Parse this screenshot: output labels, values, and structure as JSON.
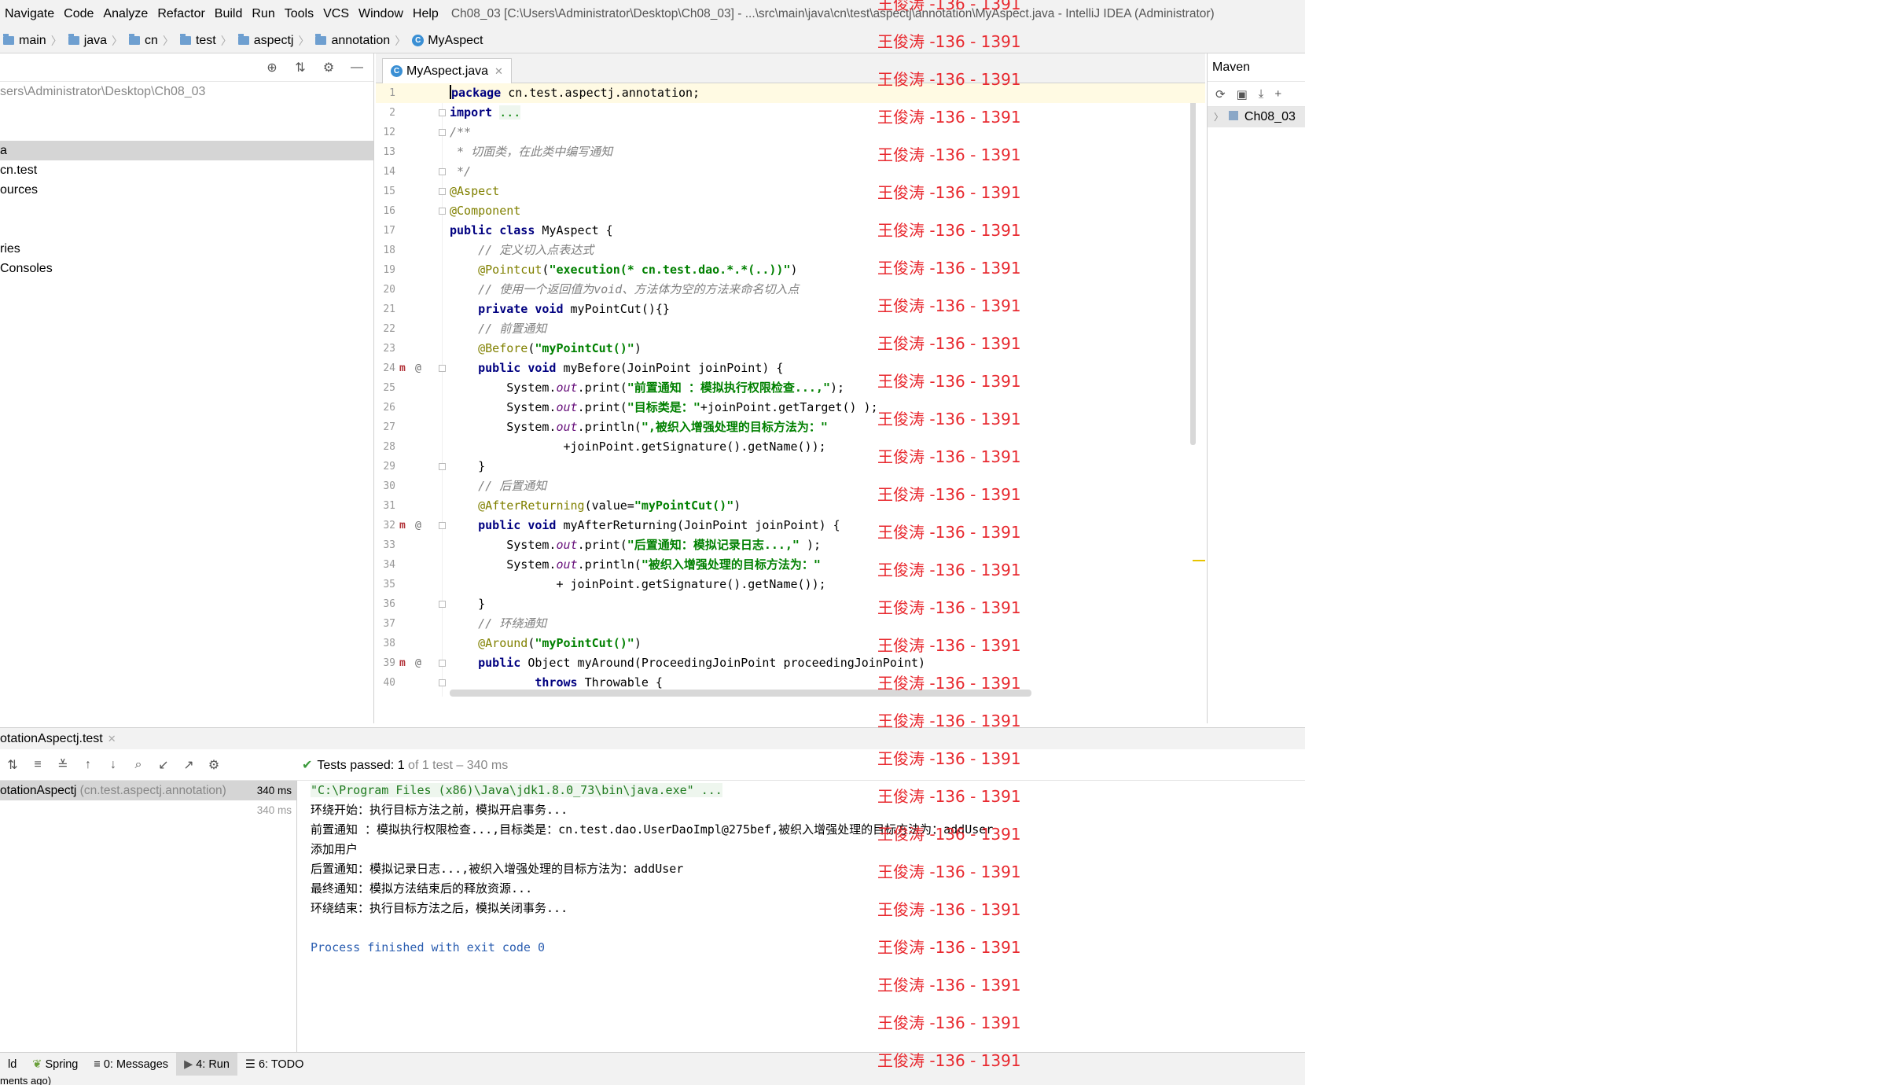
{
  "menubar": {
    "items": [
      "Navigate",
      "Code",
      "Analyze",
      "Refactor",
      "Build",
      "Run",
      "Tools",
      "VCS",
      "Window",
      "Help"
    ],
    "title": "Ch08_03 [C:\\Users\\Administrator\\Desktop\\Ch08_03] - ...\\src\\main\\java\\cn\\test\\aspectj\\annotation\\MyAspect.java - IntelliJ IDEA (Administrator)"
  },
  "breadcrumb": [
    "main",
    "java",
    "cn",
    "test",
    "aspectj",
    "annotation",
    "MyAspect"
  ],
  "project": {
    "path": "sers\\Administrator\\Desktop\\Ch08_03",
    "rows": [
      "",
      "a",
      "cn.test",
      "ources",
      "",
      "ries",
      " Consoles"
    ]
  },
  "editor": {
    "tab": "MyAspect.java",
    "lines": [
      {
        "n": "1",
        "html": "<span class=\"caret\"></span><span class=\"kw\">package</span> cn.test.aspectj.annotation;",
        "cur": true
      },
      {
        "n": "2",
        "html": "<span class=\"kw\">import</span> <span class=\"str\" style=\"font-weight:normal;background:#eef6ee\">...</span>"
      },
      {
        "n": "12",
        "html": "<span class=\"cmt\">/**</span>"
      },
      {
        "n": "13",
        "html": "<span class=\"cmt\"> * 切面类，在此类中编写通知</span>"
      },
      {
        "n": "14",
        "html": "<span class=\"cmt\"> */</span>"
      },
      {
        "n": "15",
        "html": "<span class=\"ann\">@Aspect</span>"
      },
      {
        "n": "16",
        "html": "<span class=\"ann\">@Component</span>"
      },
      {
        "n": "17",
        "html": "<span class=\"kw\">public class</span> MyAspect {"
      },
      {
        "n": "18",
        "html": "    <span class=\"cmt\">// 定义切入点表达式</span>"
      },
      {
        "n": "19",
        "html": "    <span class=\"ann\">@Pointcut</span>(<span class=\"str\">\"execution(* cn.test.dao.*.*(..))\"</span>)"
      },
      {
        "n": "20",
        "html": "    <span class=\"cmt\">// 使用一个返回值为void、方法体为空的方法来命名切入点</span>"
      },
      {
        "n": "21",
        "html": "    <span class=\"kw\">private void</span> myPointCut(){}"
      },
      {
        "n": "22",
        "html": "    <span class=\"cmt\">// 前置通知</span>"
      },
      {
        "n": "23",
        "html": "    <span class=\"ann\">@Before</span>(<span class=\"str\">\"myPointCut()\"</span>)"
      },
      {
        "n": "24",
        "html": "    <span class=\"kw\">public void</span> myBefore(JoinPoint joinPoint) {",
        "icons": true
      },
      {
        "n": "25",
        "html": "        System.<span class=\"fld\">out</span>.print(<span class=\"str\">\"前置通知 ：模拟执行权限检查...,\"</span>);"
      },
      {
        "n": "26",
        "html": "        System.<span class=\"fld\">out</span>.print(<span class=\"str\">\"目标类是：\"</span>+joinPoint.getTarget() );"
      },
      {
        "n": "27",
        "html": "        System.<span class=\"fld\">out</span>.println(<span class=\"str\">\",被织入增强处理的目标方法为：\"</span>"
      },
      {
        "n": "28",
        "html": "                +joinPoint.getSignature().getName());"
      },
      {
        "n": "29",
        "html": "    }"
      },
      {
        "n": "30",
        "html": "    <span class=\"cmt\">// 后置通知</span>"
      },
      {
        "n": "31",
        "html": "    <span class=\"ann\">@AfterReturning</span>(value=<span class=\"str\">\"myPointCut()\"</span>)"
      },
      {
        "n": "32",
        "html": "    <span class=\"kw\">public void</span> myAfterReturning(JoinPoint joinPoint) {",
        "icons": true
      },
      {
        "n": "33",
        "html": "        System.<span class=\"fld\">out</span>.print(<span class=\"str\">\"后置通知：模拟记录日志...,\"</span> );"
      },
      {
        "n": "34",
        "html": "        System.<span class=\"fld\">out</span>.println(<span class=\"str\">\"被织入增强处理的目标方法为：\"</span>"
      },
      {
        "n": "35",
        "html": "               + joinPoint.getSignature().getName());"
      },
      {
        "n": "36",
        "html": "    }"
      },
      {
        "n": "37",
        "html": "    <span class=\"cmt\">// 环绕通知</span>"
      },
      {
        "n": "38",
        "html": "    <span class=\"ann\">@Around</span>(<span class=\"str\">\"myPointCut()\"</span>)"
      },
      {
        "n": "39",
        "html": "    <span class=\"kw\">public</span> Object myAround(ProceedingJoinPoint proceedingJoinPoint)",
        "icons": true
      },
      {
        "n": "40",
        "html": "            <span class=\"kw\">throws</span> Throwable {"
      }
    ]
  },
  "maven": {
    "title": "Maven",
    "project": "Ch08_03"
  },
  "run": {
    "tab": "otationAspectj.test",
    "status_passed": "Tests passed:",
    "status_count": "1",
    "status_rest": "of 1 test – 340 ms",
    "tree": [
      {
        "name": "otationAspectj",
        "pkg": " (cn.test.aspectj.annotation)",
        "ms": "340 ms"
      },
      {
        "name": "",
        "pkg": "",
        "ms": "340 ms"
      }
    ],
    "console": [
      "\"C:\\Program Files (x86)\\Java\\jdk1.8.0_73\\bin\\java.exe\" ...",
      "环绕开始：执行目标方法之前，模拟开启事务...",
      "前置通知 ：模拟执行权限检查...,目标类是：cn.test.dao.UserDaoImpl@275bef,被织入增强处理的目标方法为：addUser",
      "添加用户",
      "后置通知：模拟记录日志...,被织入增强处理的目标方法为：addUser",
      "最终通知：模拟方法结束后的释放资源...",
      "环绕结束：执行目标方法之后，模拟关闭事务...",
      "",
      "Process finished with exit code 0"
    ]
  },
  "bottom_tabs": [
    "ld",
    "Spring",
    "0: Messages",
    "4: Run",
    "6: TODO"
  ],
  "statusbar": "ments ago)",
  "watermark": "王俊涛 -136 - 1391"
}
